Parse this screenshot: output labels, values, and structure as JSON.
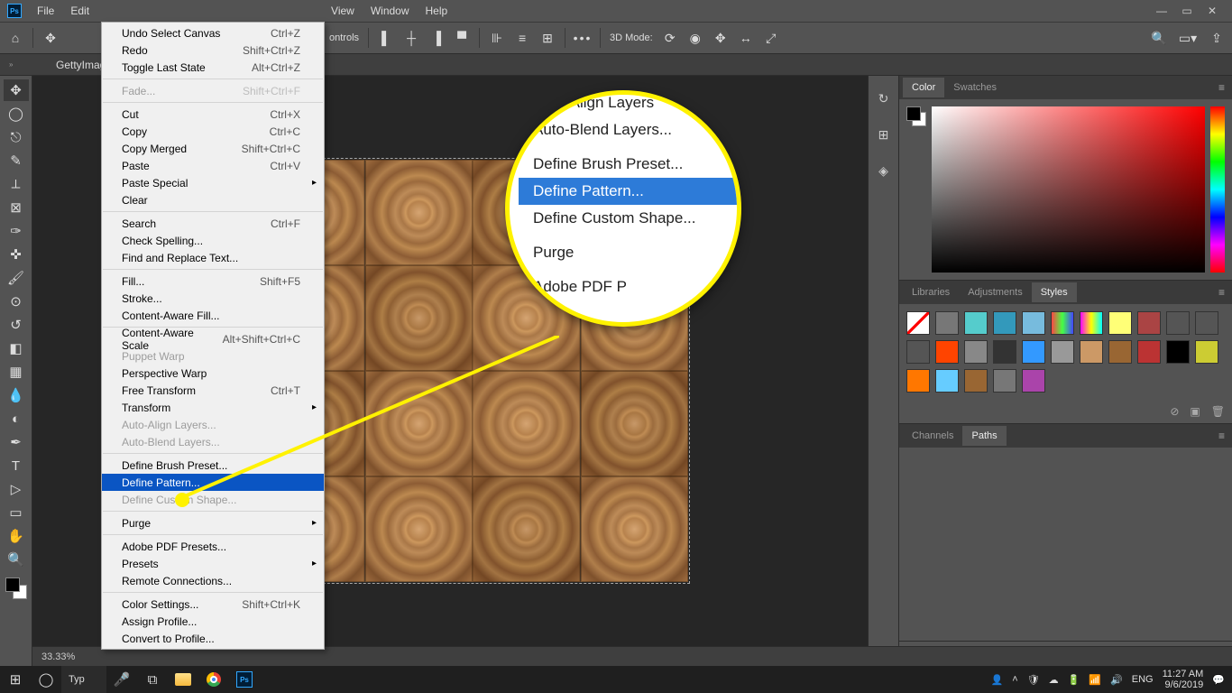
{
  "menubar": {
    "items": [
      "File",
      "Edit",
      "",
      "",
      "",
      "View",
      "Window",
      "Help"
    ]
  },
  "optionsbar": {
    "controls_label": "ontrols",
    "mode_label": "3D Mode:"
  },
  "document": {
    "tab": "GettyImag",
    "zoom": "33.33%"
  },
  "tools": [
    "move",
    "marquee-ellipse",
    "lasso",
    "quick-select",
    "crop",
    "frame",
    "eyedropper",
    "healing",
    "brush",
    "clone",
    "history-brush",
    "eraser",
    "gradient",
    "blur",
    "dodge",
    "pen",
    "type",
    "path-select",
    "rectangle",
    "hand",
    "zoom"
  ],
  "dock": [
    "history",
    "properties",
    "layers"
  ],
  "color_panel": {
    "tabs": [
      "Color",
      "Swatches"
    ],
    "active": 0
  },
  "styles_panel": {
    "tabs": [
      "Libraries",
      "Adjustments",
      "Styles"
    ],
    "active": 2,
    "swatches": [
      "#fff",
      "#777",
      "#5cc",
      "#39b",
      "#7bd",
      "#fa3 linear",
      "#f0f linear",
      "#ff7",
      "#a44",
      "#555",
      "#555",
      "#555",
      "#f40",
      "#888",
      "#333",
      "#39f",
      "#999",
      "#c96",
      "#963",
      "#b33",
      "#000",
      "#cc3",
      "#f70",
      "#6cf",
      "#963",
      "#777",
      "#a4a"
    ]
  },
  "paths_panel": {
    "tabs": [
      "Channels",
      "Paths"
    ],
    "active": 1
  },
  "edit_menu": [
    {
      "label": "Undo Select Canvas",
      "shortcut": "Ctrl+Z"
    },
    {
      "label": "Redo",
      "shortcut": "Shift+Ctrl+Z"
    },
    {
      "label": "Toggle Last State",
      "shortcut": "Alt+Ctrl+Z"
    },
    {
      "sep": true
    },
    {
      "label": "Fade...",
      "shortcut": "Shift+Ctrl+F",
      "disabled": true
    },
    {
      "sep": true
    },
    {
      "label": "Cut",
      "shortcut": "Ctrl+X"
    },
    {
      "label": "Copy",
      "shortcut": "Ctrl+C"
    },
    {
      "label": "Copy Merged",
      "shortcut": "Shift+Ctrl+C"
    },
    {
      "label": "Paste",
      "shortcut": "Ctrl+V"
    },
    {
      "label": "Paste Special",
      "sub": true
    },
    {
      "label": "Clear"
    },
    {
      "sep": true
    },
    {
      "label": "Search",
      "shortcut": "Ctrl+F"
    },
    {
      "label": "Check Spelling..."
    },
    {
      "label": "Find and Replace Text..."
    },
    {
      "sep": true
    },
    {
      "label": "Fill...",
      "shortcut": "Shift+F5"
    },
    {
      "label": "Stroke..."
    },
    {
      "label": "Content-Aware Fill..."
    },
    {
      "sep": true
    },
    {
      "label": "Content-Aware Scale",
      "shortcut": "Alt+Shift+Ctrl+C"
    },
    {
      "label": "Puppet Warp",
      "disabled": true
    },
    {
      "label": "Perspective Warp"
    },
    {
      "label": "Free Transform",
      "shortcut": "Ctrl+T"
    },
    {
      "label": "Transform",
      "sub": true
    },
    {
      "label": "Auto-Align Layers...",
      "disabled": true
    },
    {
      "label": "Auto-Blend Layers...",
      "disabled": true
    },
    {
      "sep": true
    },
    {
      "label": "Define Brush Preset..."
    },
    {
      "label": "Define Pattern...",
      "selected": true
    },
    {
      "label": "Define Custom Shape...",
      "disabled": true
    },
    {
      "sep": true
    },
    {
      "label": "Purge",
      "sub": true
    },
    {
      "sep": true
    },
    {
      "label": "Adobe PDF Presets..."
    },
    {
      "label": "Presets",
      "sub": true
    },
    {
      "label": "Remote Connections..."
    },
    {
      "sep": true
    },
    {
      "label": "Color Settings...",
      "shortcut": "Shift+Ctrl+K"
    },
    {
      "label": "Assign Profile..."
    },
    {
      "label": "Convert to Profile..."
    }
  ],
  "callout": {
    "items": [
      {
        "label": "Auto-Align Layers"
      },
      {
        "label": "Auto-Blend Layers..."
      },
      {
        "spacer": true
      },
      {
        "label": "Define Brush Preset..."
      },
      {
        "label": "Define Pattern...",
        "selected": true
      },
      {
        "label": "Define Custom Shape..."
      },
      {
        "spacer": true
      },
      {
        "label": "Purge"
      },
      {
        "spacer": true
      },
      {
        "label": "Adobe PDF P"
      }
    ]
  },
  "taskbar": {
    "search_placeholder": "Typ",
    "lang": "ENG",
    "time": "11:27 AM",
    "date": "9/6/2019"
  }
}
